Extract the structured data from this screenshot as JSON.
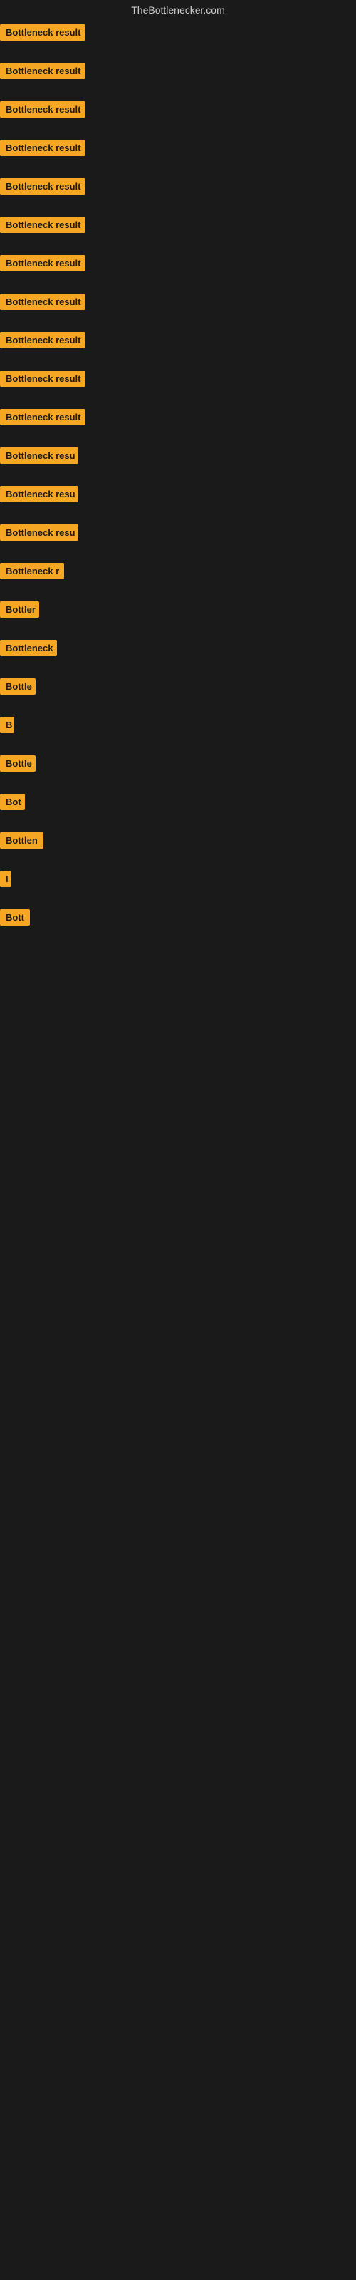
{
  "site": {
    "title": "TheBottlenecker.com"
  },
  "items": [
    {
      "id": 1,
      "label": "Bottleneck result",
      "badge_width": 120
    },
    {
      "id": 2,
      "label": "Bottleneck result",
      "badge_width": 120
    },
    {
      "id": 3,
      "label": "Bottleneck result",
      "badge_width": 120
    },
    {
      "id": 4,
      "label": "Bottleneck result",
      "badge_width": 120
    },
    {
      "id": 5,
      "label": "Bottleneck result",
      "badge_width": 120
    },
    {
      "id": 6,
      "label": "Bottleneck result",
      "badge_width": 120
    },
    {
      "id": 7,
      "label": "Bottleneck result",
      "badge_width": 120
    },
    {
      "id": 8,
      "label": "Bottleneck result",
      "badge_width": 120
    },
    {
      "id": 9,
      "label": "Bottleneck result",
      "badge_width": 120
    },
    {
      "id": 10,
      "label": "Bottleneck result",
      "badge_width": 120
    },
    {
      "id": 11,
      "label": "Bottleneck result",
      "badge_width": 120
    },
    {
      "id": 12,
      "label": "Bottleneck resu",
      "badge_width": 110
    },
    {
      "id": 13,
      "label": "Bottleneck resu",
      "badge_width": 110
    },
    {
      "id": 14,
      "label": "Bottleneck resu",
      "badge_width": 110
    },
    {
      "id": 15,
      "label": "Bottleneck r",
      "badge_width": 90
    },
    {
      "id": 16,
      "label": "Bottler",
      "badge_width": 55
    },
    {
      "id": 17,
      "label": "Bottleneck",
      "badge_width": 80
    },
    {
      "id": 18,
      "label": "Bottle",
      "badge_width": 50
    },
    {
      "id": 19,
      "label": "B",
      "badge_width": 20
    },
    {
      "id": 20,
      "label": "Bottle",
      "badge_width": 50
    },
    {
      "id": 21,
      "label": "Bot",
      "badge_width": 35
    },
    {
      "id": 22,
      "label": "Bottlen",
      "badge_width": 62
    },
    {
      "id": 23,
      "label": "I",
      "badge_width": 14
    },
    {
      "id": 24,
      "label": "Bott",
      "badge_width": 42
    }
  ]
}
